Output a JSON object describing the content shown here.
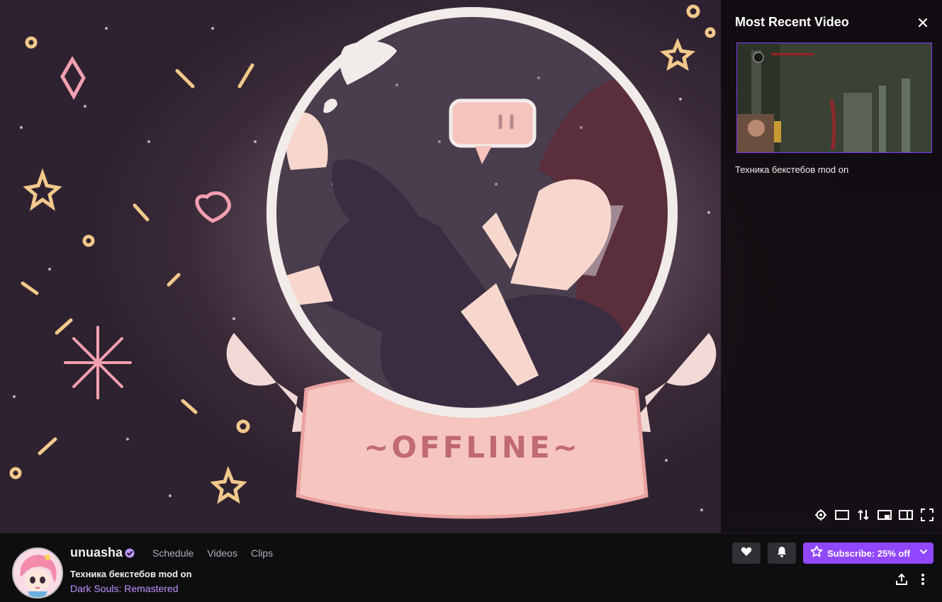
{
  "overlay": {
    "title": "Most Recent Video",
    "video_title": "Техника бекстебов mod on"
  },
  "offline_banner": {
    "text": "~OFFLINE~"
  },
  "player_controls": [
    "gear-icon",
    "theatre-mode-icon",
    "swap-icon",
    "miniplayer-icon",
    "sidebar-icon",
    "fullscreen-icon"
  ],
  "channel": {
    "name": "unuasha",
    "tabs": [
      "Schedule",
      "Videos",
      "Clips"
    ],
    "stream_title": "Техника бекстебов mod on",
    "game": "Dark Souls: Remastered"
  },
  "actions": {
    "subscribe_label": "Subscribe: 25% off"
  },
  "colors": {
    "accent": "#9147ff",
    "link": "#bf94ff",
    "background": "#0e0e10",
    "button_dark": "#2f2f35"
  }
}
